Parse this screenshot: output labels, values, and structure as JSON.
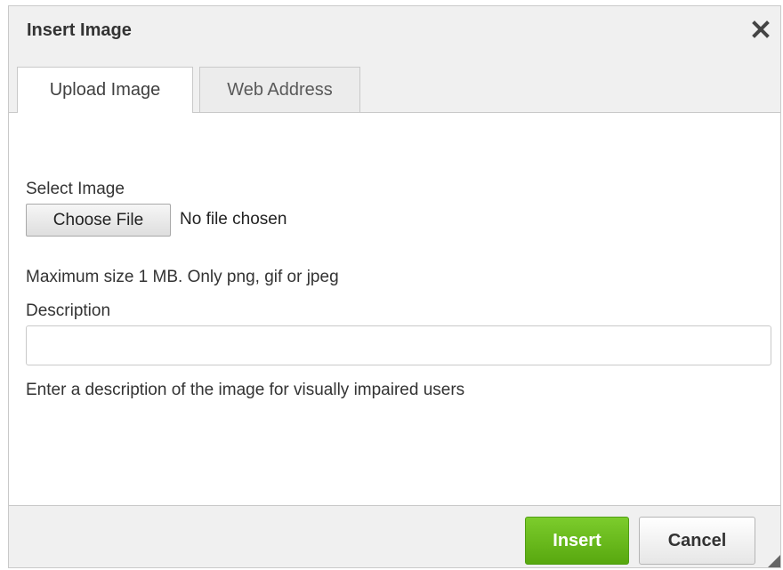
{
  "dialog": {
    "title": "Insert Image",
    "close_icon": "close-icon"
  },
  "tabs": [
    {
      "label": "Upload Image",
      "active": true
    },
    {
      "label": "Web Address",
      "active": false
    }
  ],
  "upload": {
    "select_label": "Select Image",
    "choose_button_label": "Choose File",
    "file_status": "No file chosen",
    "size_hint": "Maximum size 1 MB. Only png, gif or jpeg"
  },
  "description": {
    "label": "Description",
    "value": "",
    "placeholder": "",
    "help_text": "Enter a description of the image for visually impaired users"
  },
  "footer": {
    "insert_label": "Insert",
    "cancel_label": "Cancel"
  },
  "colors": {
    "insert_button": "#6ab820",
    "titlebar": "#f0f0f0"
  }
}
